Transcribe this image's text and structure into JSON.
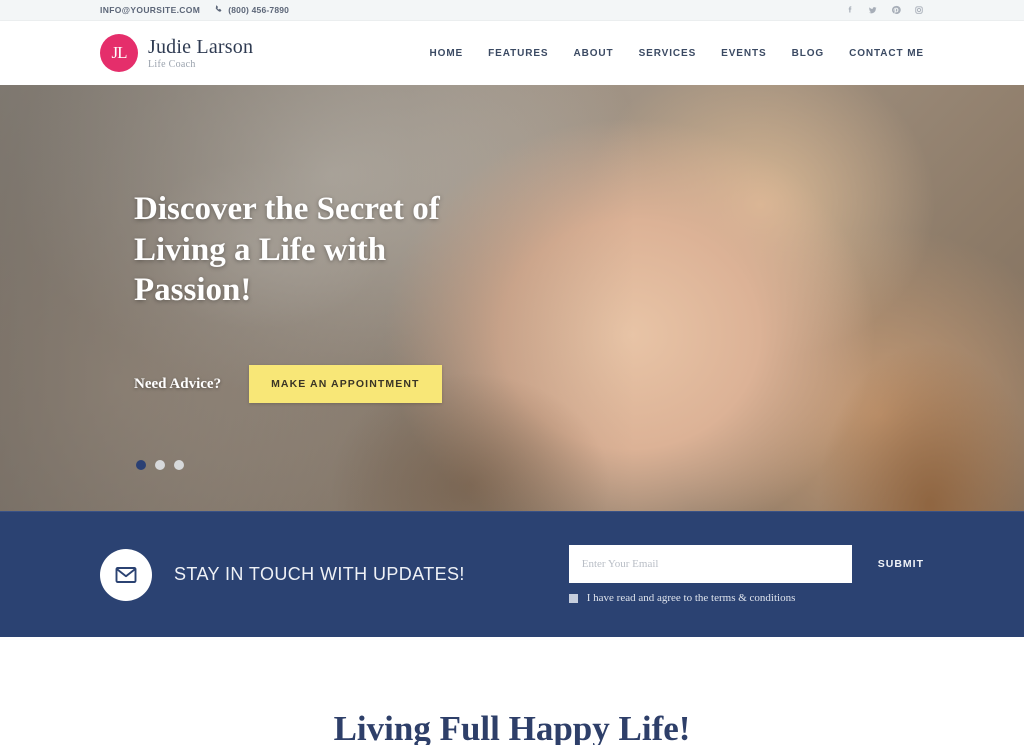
{
  "topbar": {
    "email": "INFO@YOURSITE.COM",
    "phone": "(800) 456-7890",
    "phone_icon": "phone-icon",
    "social": [
      {
        "name": "facebook-icon",
        "label": "Facebook"
      },
      {
        "name": "twitter-icon",
        "label": "Twitter"
      },
      {
        "name": "pinterest-icon",
        "label": "Pinterest"
      },
      {
        "name": "instagram-icon",
        "label": "Instagram"
      }
    ]
  },
  "header": {
    "logo_monogram": "JL",
    "brand_name": "Judie Larson",
    "brand_tagline": "Life Coach",
    "nav": [
      {
        "label": "HOME"
      },
      {
        "label": "FEATURES"
      },
      {
        "label": "ABOUT"
      },
      {
        "label": "SERVICES"
      },
      {
        "label": "EVENTS"
      },
      {
        "label": "BLOG"
      },
      {
        "label": "CONTACT ME"
      }
    ]
  },
  "hero": {
    "title": "Discover the Secret of Living a Life with Passion!",
    "advice_label": "Need Advice?",
    "button_label": "MAKE AN APPOINTMENT",
    "slider": {
      "total": 3,
      "active_index": 0
    }
  },
  "newsletter": {
    "icon": "envelope-icon",
    "title": "STAY IN TOUCH WITH UPDATES!",
    "input_placeholder": "Enter Your Email",
    "input_value": "",
    "submit_label": "SUBMIT",
    "terms_label": "I have read and agree to the terms & conditions",
    "terms_checked": true
  },
  "section": {
    "title": "Living Full Happy Life!"
  },
  "colors": {
    "accent_pink": "#e52e6b",
    "navy": "#2b4272",
    "yellow": "#f8e777",
    "heading_navy": "#2e3f69",
    "topbar_bg": "#f3f6f7"
  }
}
